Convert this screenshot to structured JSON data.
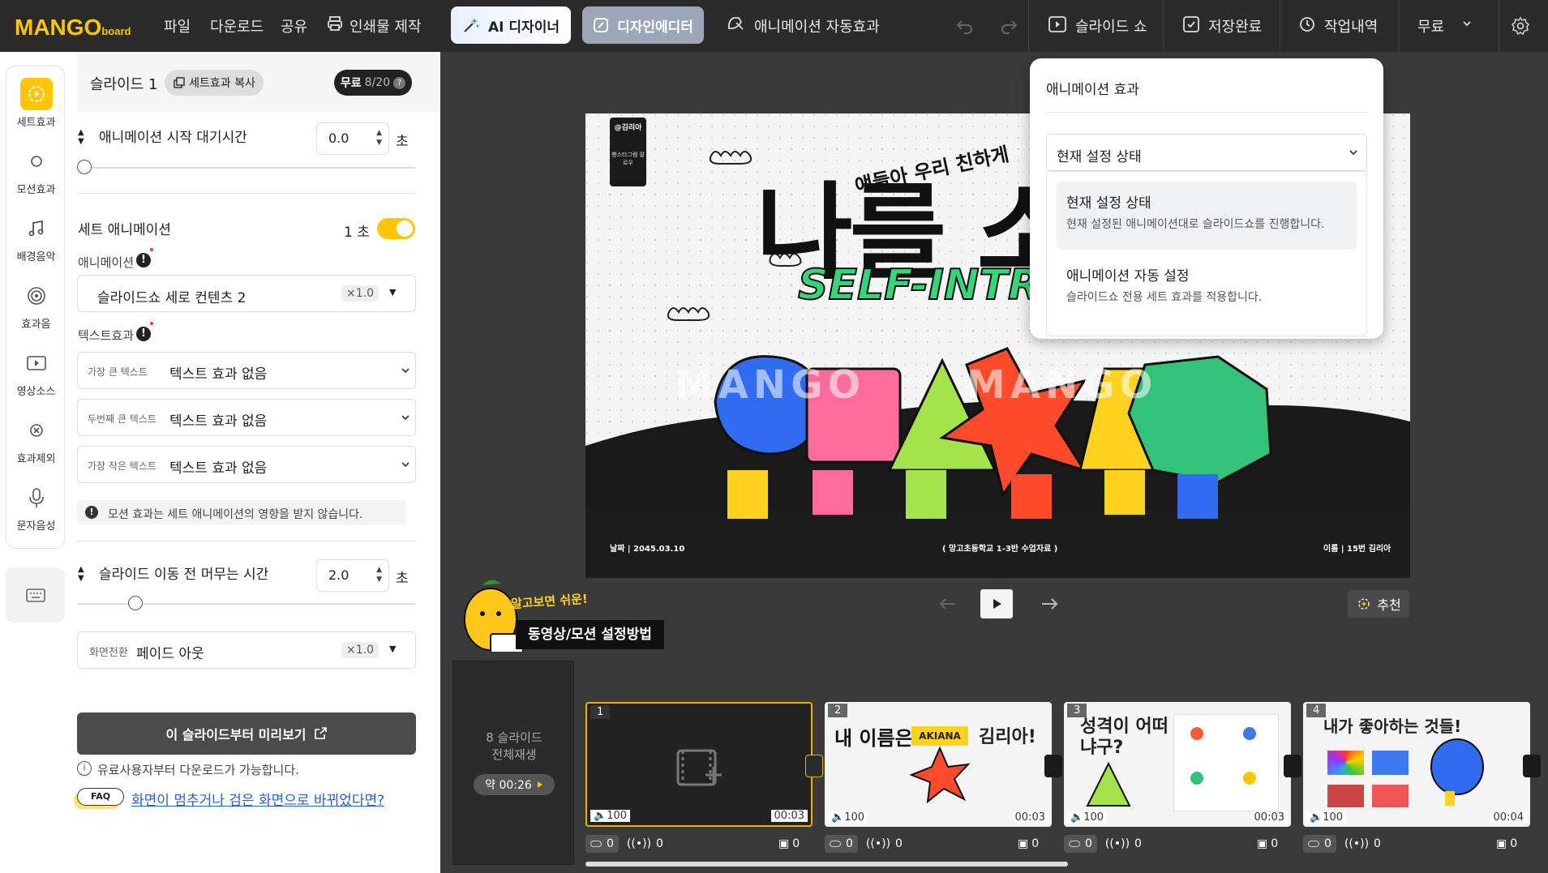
{
  "topbar": {
    "logo": "MANGO",
    "logo_sub": "board",
    "menu": [
      "파일",
      "다운로드",
      "공유"
    ],
    "print": "인쇄물 제작",
    "ai_designer": "AI 디자이너",
    "design_editor": "디자인에디터",
    "anim_auto": "애니메이션 자동효과",
    "slideshow": "슬라이드 쇼",
    "save": "저장완료",
    "history": "작업내역",
    "plan": "무료"
  },
  "tools": [
    "세트효과",
    "모션효과",
    "배경음악",
    "효과음",
    "영상소스",
    "효과제외",
    "문자음성"
  ],
  "panel": {
    "slide_title": "슬라이드 1",
    "copy_btn": "세트효과 복사",
    "free_badge": "무료",
    "free_count": "8/20",
    "wait_label": "애니메이션 시작 대기시간",
    "wait_value": "0.0",
    "sec": "초",
    "set_anim": "세트 애니메이션",
    "set_anim_sec": "1 초",
    "anim_label": "애니메이션",
    "anim_value": "슬라이드쇼 세로 컨텐츠 2",
    "speed": "×1.0",
    "text_effect": "텍스트효과",
    "text_rows": [
      {
        "label": "가장 큰 텍스트",
        "value": "텍스트 효과 없음"
      },
      {
        "label": "두번째 큰 텍스트",
        "value": "텍스트 효과 없음"
      },
      {
        "label": "가장 작은 텍스트",
        "value": "텍스트 효과 없음"
      }
    ],
    "info": "모션 효과는 세트 애니메이션의 영향을 받지 않습니다.",
    "stay_label": "슬라이드 이동 전 머무는 시간",
    "stay_value": "2.0",
    "transition_label": "화면전환",
    "transition_value": "페이드 아웃",
    "preview_btn": "이 슬라이드부터 미리보기",
    "paid_note": "유료사용자부터 다운로드가 가능합니다.",
    "faq": "FAQ",
    "faq_link": "화면이 멈추거나 검은 화면으로 바뀌었다면?"
  },
  "slide": {
    "tag": "@김리아",
    "tag_sub": "빵스타그램 팔로우",
    "greeting": "얘들아 우리 친하게",
    "title": "나를 소개",
    "subtitle": "SELF-INTR",
    "date": "날짜 | 2045.03.10",
    "school": "( 망고초등학교 1-3반 수업자료 )",
    "name": "이름 | 15번 김리아",
    "watermark": "MANGO"
  },
  "popup": {
    "title": "애니메이션 효과",
    "selected": "현재 설정 상태",
    "options": [
      {
        "title": "현재 설정 상태",
        "desc": "현재 설정된 애니메이션대로 슬라이드쇼를 진행합니다."
      },
      {
        "title": "애니메이션 자동 설정",
        "desc": "슬라이드쇼 전용 세트 효과를 적용합니다."
      }
    ]
  },
  "player": {
    "recommend": "추천"
  },
  "helper": {
    "tip": "알고보면 쉬운!",
    "title": "동영상/모션 설정방법"
  },
  "filmstrip": {
    "all_label": "8 슬라이드\n전체재생",
    "duration": "약 00:26",
    "slides": [
      {
        "num": "1",
        "vol": "100",
        "time": "00:03",
        "c1": "0",
        "c2": "0",
        "c3": "0"
      },
      {
        "num": "2",
        "vol": "100",
        "time": "00:03",
        "c1": "0",
        "c2": "0",
        "c3": "0",
        "title": "내 이름은",
        "name": "AKIANA",
        "tail": "김리아!"
      },
      {
        "num": "3",
        "vol": "100",
        "time": "00:03",
        "c1": "0",
        "c2": "0",
        "c3": "0",
        "title": "성격이 어떠냐구?"
      },
      {
        "num": "4",
        "vol": "100",
        "time": "00:04",
        "c1": "0",
        "c2": "0",
        "c3": "0",
        "title": "내가 좋아하는 것들!"
      }
    ]
  }
}
